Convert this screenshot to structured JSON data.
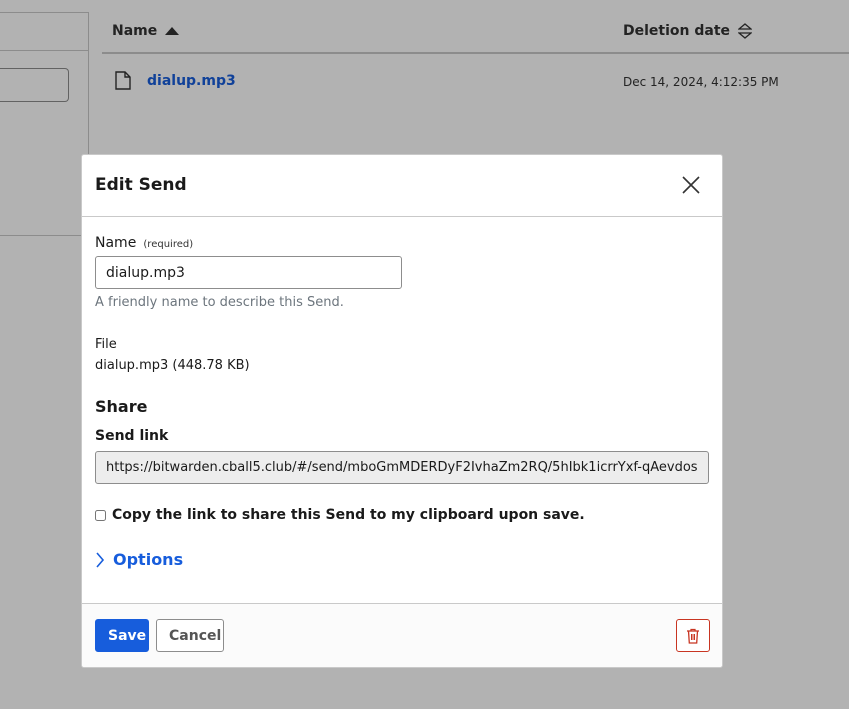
{
  "background": {
    "table": {
      "columns": [
        {
          "label": "Name",
          "sort": "ascending"
        },
        {
          "label": "Deletion date",
          "sort": "none"
        }
      ],
      "rows": [
        {
          "name": "dialup.mp3",
          "deletion_date": "Dec 14, 2024, 4:12:35 PM"
        }
      ]
    }
  },
  "dialog": {
    "title": "Edit Send",
    "name_label": "Name",
    "name_required": "(required)",
    "name_value": "dialup.mp3",
    "name_hint": "A friendly name to describe this Send.",
    "file_label": "File",
    "file_value": "dialup.mp3 (448.78 KB)",
    "share_heading": "Share",
    "send_link_label": "Send link",
    "send_link_value": "https://bitwarden.cball5.club/#/send/mboGmMDERDyF2IvhaZm2RQ/5hIbk1icrrYxf-qAevdos",
    "copy_checkbox_label": "Copy the link to share this Send to my clipboard upon save.",
    "copy_checked": false,
    "options_label": "Options",
    "save_label": "Save",
    "cancel_label": "Cancel"
  },
  "colors": {
    "primary": "#175ddc",
    "danger": "#c83522",
    "muted": "#6c757d"
  },
  "icons": [
    "file-icon",
    "sort-up-icon",
    "sort-both-icon",
    "close-icon",
    "chevron-right-icon",
    "trash-icon"
  ]
}
